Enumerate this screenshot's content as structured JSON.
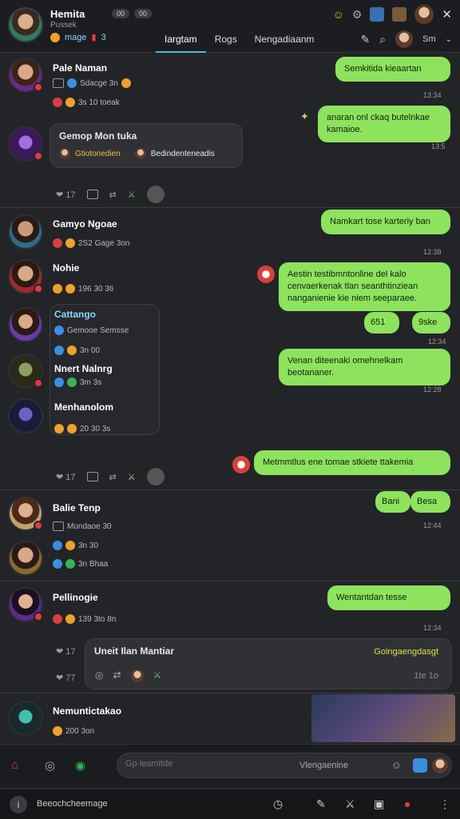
{
  "header": {
    "name": "Hemita",
    "sub": "Pussek",
    "status": "mage",
    "pill1": "00",
    "pill2": "00",
    "count": "3",
    "tabs": [
      "Iargtam",
      "Rogs",
      "Nengadiaanm"
    ],
    "menu": "Sm"
  },
  "threads": [
    {
      "name": "Pale Naman",
      "meta": "Sdacge 3n",
      "meta2": "3s 10 toeak",
      "bubble": "Gemop Mon tuka",
      "bubble_sub": "Gtiotonedien",
      "bubble_sub2": "Bedindenteneadis",
      "reply1": "Semkitida kieaartan",
      "time1": "13:34",
      "reply2": "anaran onl ckaq  butelnkae kamaioe.",
      "time2": "13:5",
      "actions": [
        "17",
        "",
        "",
        ""
      ]
    }
  ],
  "threads2": [
    {
      "name": "Gamyo Ngoae",
      "meta": "2S2 Gage 3on",
      "reply": "Namkart tose karteriy ban",
      "time": "12:38"
    },
    {
      "name": "Nohie",
      "meta": "196 30 3ti",
      "reply": "Aestin testibmntonline del kalo cenvaerkenak tlan seanthtinziean nanganienie kie niem seeparaee.",
      "time": "12:34"
    },
    {
      "name": "Cattango",
      "meta": "Gemooe Semsse",
      "sub": "3n 00"
    },
    {
      "name": "Nnert Nalnrg",
      "meta": "3m  3s"
    },
    {
      "name": "Menhanolom",
      "meta": "20 30 3s"
    }
  ],
  "small_replies": [
    "651",
    "9ske"
  ],
  "small_time": "12:34",
  "reply3": "Venan diteenaki omehnelkam beotananer.",
  "time3": "12:28",
  "actions2": [
    "17"
  ],
  "reply4": "Metmmtlus ene tomae stkiete ttakemia",
  "reply4_small": [
    "Bani",
    "Besa"
  ],
  "time4": "12:44",
  "thread3": {
    "name": "Balie Tenp",
    "meta": "Mundaoe 30",
    "meta2": "3n 30",
    "meta3": "3n  Bhaa"
  },
  "thread4": {
    "name": "Pellinogie",
    "meta": "139 3to 8n",
    "reply": "Wentantdan tesse",
    "time": "12:34"
  },
  "panel": {
    "title": "Uneit Ilan Mantiar",
    "action": "Goingaengdasgt",
    "side": "1te 1o",
    "count": "17",
    "count2": "77"
  },
  "thread5": {
    "name": "Nemuntictakao",
    "meta": "200 3on"
  },
  "composer": {
    "placeholder": "Gp leamitde",
    "hint": "Vlengaenine"
  },
  "bottombar": {
    "label": "Beeochcheemage"
  }
}
